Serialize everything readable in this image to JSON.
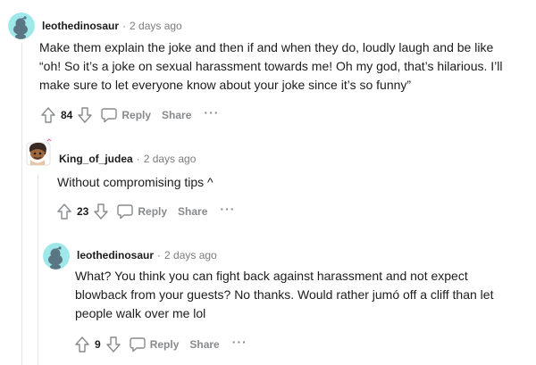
{
  "comments": [
    {
      "username": "leothedinosaur",
      "separator": "·",
      "time": "2 days ago",
      "lines": [
        "Make them explain the joke and then if and when they do, loudly laugh and be like",
        "“oh! So it’s a joke on sexual harassment towards me! Oh my god, that’s hilarious. I’ll",
        "make sure to let everyone know about your joke since it’s so funny”"
      ],
      "score": "84",
      "reply_label": "Reply",
      "share_label": "Share",
      "more_label": "···"
    },
    {
      "username": "King_of_judea",
      "separator": "·",
      "time": "2 days ago",
      "lines": [
        "Without compromising tips ^"
      ],
      "score": "23",
      "reply_label": "Reply",
      "share_label": "Share",
      "more_label": "···"
    },
    {
      "username": "leothedinosaur",
      "separator": "·",
      "time": "2 days ago",
      "lines": [
        "What? You think you can fight back against harassment and not expect",
        "blowback from your guests? No thanks. Would rather jumó off a cliff than let",
        "people walk over me lol"
      ],
      "score": "9",
      "reply_label": "Reply",
      "share_label": "Share",
      "more_label": "···"
    }
  ],
  "icons": {
    "upvote": "upvote-arrow-icon",
    "downvote": "downvote-arrow-icon",
    "reply": "speech-bubble-icon",
    "avatar_default": "snoo-avatar-icon",
    "avatar_custom": "dinosaur-avatar-icon"
  },
  "colors": {
    "avatar_background": "#9ee8ea",
    "snoo": "#5a7684",
    "muted_text": "#7c7c7c",
    "action_text": "#878a8c",
    "thread_line": "#e5e5e5"
  }
}
